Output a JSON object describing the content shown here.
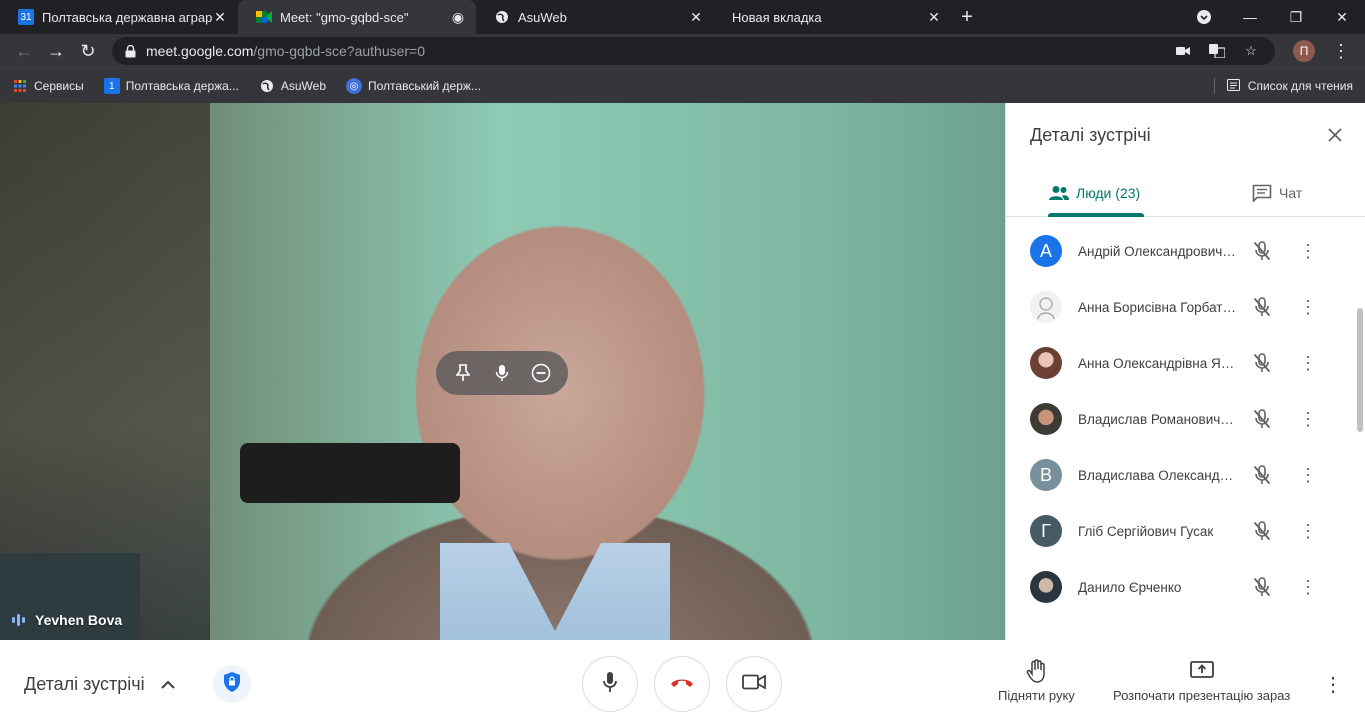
{
  "browser": {
    "tabs": [
      {
        "title": "Полтавська державна аграрна а",
        "icon": "calendar-icon",
        "active": false
      },
      {
        "title": "Meet: \"gmo-gqbd-sce\"",
        "icon": "meet-icon",
        "active": true
      },
      {
        "title": "AsuWeb",
        "icon": "globe-icon",
        "active": false
      },
      {
        "title": "Новая вкладка",
        "icon": "",
        "active": false
      }
    ],
    "url_host": "meet.google.com",
    "url_path": "/gmo-gqbd-sce?authuser=0",
    "profile_initial": "П",
    "bookmarks": [
      {
        "label": "Сервисы",
        "icon": "apps-grid-icon"
      },
      {
        "label": "Полтавська держа...",
        "icon": "calendar-icon"
      },
      {
        "label": "AsuWeb",
        "icon": "globe-icon"
      },
      {
        "label": "Полтавський держ...",
        "icon": "site-icon"
      }
    ],
    "reading_list": "Список для чтения"
  },
  "video": {
    "speaker_name": "Yevhen Bova"
  },
  "panel": {
    "title": "Деталі зустрічі",
    "tab_people": "Люди (23)",
    "tab_chat": "Чат",
    "participants": [
      {
        "name": "Андрій Олександрович Бабак",
        "initial": "А",
        "color": "#1a73e8"
      },
      {
        "name": "Анна Борисівна Горбатюк",
        "initial": "",
        "color": "#ffffff"
      },
      {
        "name": "Анна Олександрівна Яковенко",
        "initial": "",
        "color": "#c48b8b"
      },
      {
        "name": "Владислав Романович Лук'яненко",
        "initial": "",
        "color": "#6b4b3a"
      },
      {
        "name": "Владислава Олександрівна Коваленко",
        "initial": "В",
        "color": "#78909c"
      },
      {
        "name": "Гліб Сергійович Гусак",
        "initial": "Г",
        "color": "#455a64"
      },
      {
        "name": "Данило Єрченко",
        "initial": "",
        "color": "#37474f"
      }
    ]
  },
  "bottom": {
    "meeting_details": "Деталі зустрічі",
    "raise_hand": "Підняти руку",
    "present_now": "Розпочати презентацію зараз"
  },
  "colors": {
    "accent": "#00796b",
    "end_call": "#d93025",
    "chrome_bg": "#202124"
  }
}
